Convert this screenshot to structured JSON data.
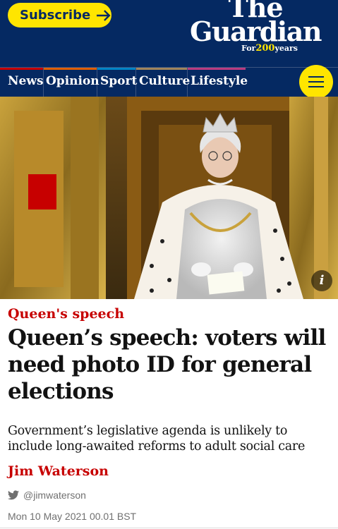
{
  "header": {
    "subscribe_label": "Subscribe",
    "logo": {
      "line1": "The",
      "line2": "Guardian",
      "for": "For",
      "num": "200",
      "years": "years"
    }
  },
  "nav": {
    "items": [
      {
        "label": "News",
        "color": "#c70000"
      },
      {
        "label": "Opinion",
        "color": "#e05e00"
      },
      {
        "label": "Sport",
        "color": "#0084c6"
      },
      {
        "label": "Culture",
        "color": "#a1845c"
      },
      {
        "label": "Lifestyle",
        "color": "#bb3b80"
      }
    ],
    "menu_icon": "hamburger-icon"
  },
  "hero": {
    "info_label": "i"
  },
  "article": {
    "kicker": "Queen's speech",
    "headline": "Queen’s speech: voters will need photo ID for general elections",
    "standfirst": "Government’s legislative agenda is unlikely to include long-awaited reforms to adult social care",
    "byline": "Jim Waterson",
    "twitter_handle": "@jimwaterson",
    "date": "Mon 10 May 2021 00.01 BST"
  },
  "colors": {
    "brand_blue": "#052962",
    "subscribe_yellow": "#ffe500",
    "news_red": "#c70000"
  }
}
